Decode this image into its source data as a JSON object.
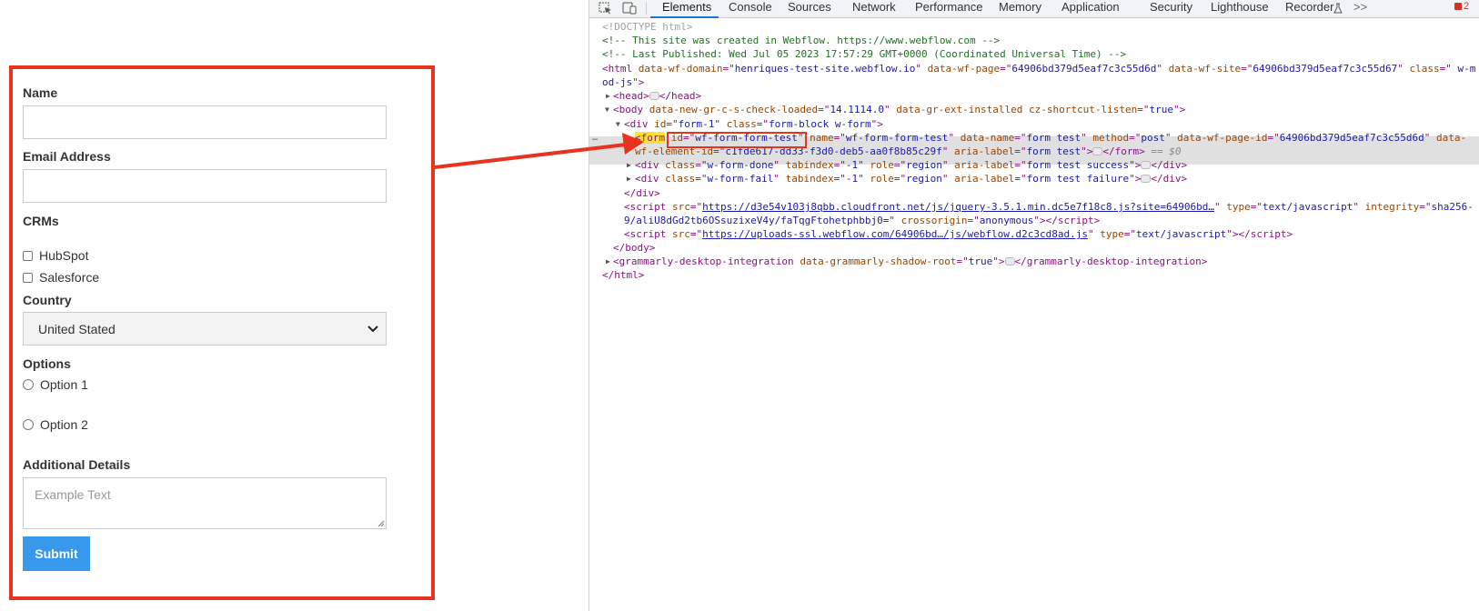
{
  "form": {
    "name_label": "Name",
    "email_label": "Email Address",
    "crms_label": "CRMs",
    "crm_options": [
      "HubSpot",
      "Salesforce"
    ],
    "country_label": "Country",
    "country_value": "United Stated",
    "options_label": "Options",
    "radio_options": [
      "Option 1",
      "Option 2"
    ],
    "details_label": "Additional Details",
    "details_placeholder": "Example Text",
    "submit_label": "Submit"
  },
  "devtools": {
    "tabs": [
      "Elements",
      "Console",
      "Sources",
      "Network",
      "Performance",
      "Memory",
      "Application",
      "Security",
      "Lighthouse",
      "Recorder"
    ],
    "active_tab": "Elements",
    "more_tabs": ">>",
    "error_count": "2",
    "selected_suffix": "== $0",
    "code": {
      "doctype": "<!DOCTYPE html>",
      "comment1": "<!-- This site was created in Webflow. https://www.webflow.com -->",
      "comment2": "<!-- Last Published: Wed Jul 05 2023 17:57:29 GMT+0000 (Coordinated Universal Time) -->",
      "html_domain": "henriques-test-site.webflow.io",
      "html_page": "64906bd379d5eaf7c3c55d6d",
      "html_site": "64906bd379d5eaf7c3c55d67",
      "html_class_a": " w-m",
      "html_class_b": "od-js",
      "body_gr": "14.1114.0",
      "body_cz": "true",
      "div_id": "form-1",
      "div_class": "form-block w-form",
      "form_id": "wf-form-form-test",
      "form_name": "wf-form-form-test",
      "form_dataname": "form test",
      "form_method": "post",
      "form_pageid": "64906bd379d5eaf7c3c55d6d",
      "form_elementid": "c1fde617-dd33-f3d0-deb5-aa0f8b85c29f",
      "form_aria": "form test",
      "done_class": "w-form-done",
      "done_tabindex": "-1",
      "done_role": "region",
      "done_aria": "form test success",
      "fail_class": "w-form-fail",
      "fail_tabindex": "-1",
      "fail_role": "region",
      "fail_aria": "form test failure",
      "script1_src": "https://d3e54v103j8qbb.cloudfront.net/js/jquery-3.5.1.min.dc5e7f18c8.js?site=64906bd…",
      "script1_type": "text/javascript",
      "script1_integrity_a": "sha256-",
      "script1_integrity_b": "9/aliU8dGd2tb6OSsuzixeV4y/faTqgFtohetphbbj0=",
      "script1_crossorigin": "anonymous",
      "script2_src": "https://uploads-ssl.webflow.com/64906bd…/js/webflow.d2c3cd8ad.js",
      "script2_type": "text/javascript",
      "grammarly_attr": "true"
    }
  },
  "colors": {
    "highlight": "#e8341f",
    "submit_bg": "#3898ec",
    "tab_accent": "#1a73e8"
  }
}
